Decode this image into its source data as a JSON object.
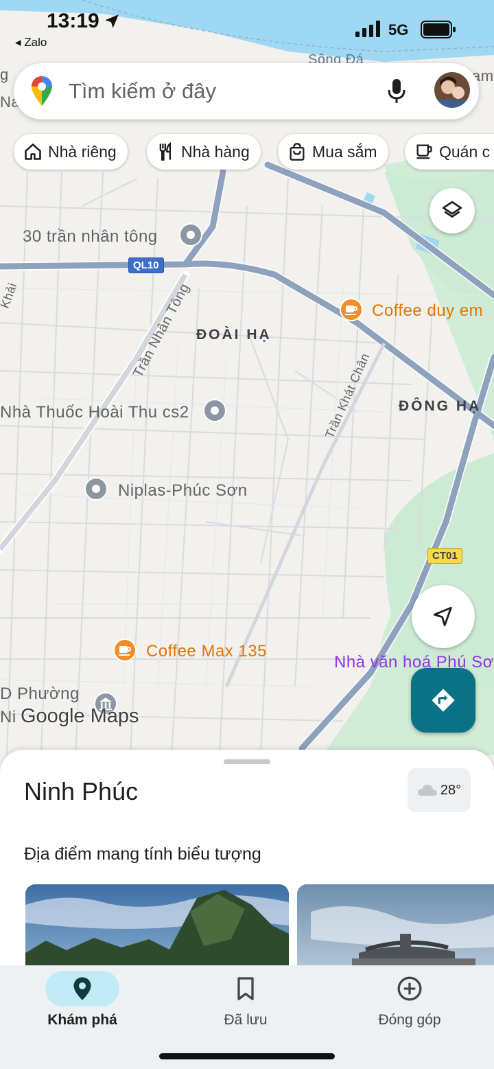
{
  "status_bar": {
    "time": "13:19",
    "back_app": "◂ Zalo",
    "network": "5G"
  },
  "search": {
    "placeholder": "Tìm kiếm ở đây"
  },
  "chips": [
    {
      "label": "Nhà riêng",
      "icon": "home-icon"
    },
    {
      "label": "Nhà hàng",
      "icon": "restaurant-icon"
    },
    {
      "label": "Mua sắm",
      "icon": "shopping-bag-icon"
    },
    {
      "label": "Quán c",
      "icon": "cafe-icon"
    }
  ],
  "map": {
    "places": [
      {
        "name": "30 trần nhân tông"
      },
      {
        "name": "Nhà Thuốc Hoài Thu cs2"
      },
      {
        "name": "Niplas-Phúc Sơn"
      },
      {
        "name": "Coffee duy em"
      },
      {
        "name": "Coffee Max 135"
      },
      {
        "name": "Nhà văn hoá Phú Sơ"
      },
      {
        "name": "D Phường"
      },
      {
        "name": "Ni"
      }
    ],
    "areas": {
      "doai_ha": "ĐOÀI HẠ",
      "dong_ha": "ĐÔNG HẠ"
    },
    "roads": {
      "tran_nhan_tong": "Trần Nhân Tông",
      "tran_khat_chan": "Trần Khát Chân",
      "khai": "Khải",
      "song_day": "Sông Đá",
      "top_left_a": "g",
      "top_left_b": "Na",
      "top_right": "am"
    },
    "shields": {
      "ql10": "QL10",
      "ct01": "CT01"
    },
    "logo": "Google Maps"
  },
  "sheet": {
    "title": "Ninh Phúc",
    "weather": "28°",
    "section_title": "Địa điểm mang tính biểu tượng"
  },
  "bottom_nav": [
    {
      "label": "Khám phá",
      "icon": "explore-pin-icon",
      "active": true
    },
    {
      "label": "Đã lưu",
      "icon": "bookmark-icon",
      "active": false
    },
    {
      "label": "Đóng góp",
      "icon": "add-circle-icon",
      "active": false
    }
  ],
  "colors": {
    "accent": "#0b7285",
    "nav_pill": "#c2ebf7",
    "cafe": "#e37400",
    "road": "#8ea1bd"
  }
}
